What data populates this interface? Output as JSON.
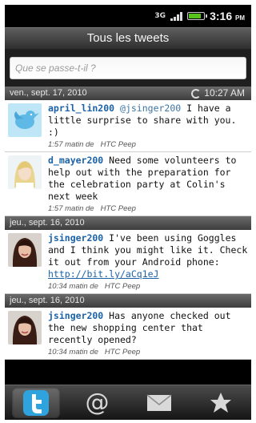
{
  "status_bar": {
    "network": "3G",
    "battery_level": 0.85,
    "time": "3:16",
    "time_suffix": "PM"
  },
  "header": {
    "title": "Tous les tweets"
  },
  "compose": {
    "placeholder": "Que se passe-t-il ?"
  },
  "groups": [
    {
      "date": "ven., sept. 17, 2010",
      "refresh_time": "10:27 AM"
    },
    {
      "date": "jeu., sept. 16, 2010"
    },
    {
      "date": "jeu., sept. 16, 2010"
    }
  ],
  "tweets": [
    {
      "user": "april_lin200",
      "mention": "@jsinger200",
      "text": " I have a little surprise to share with you. :)",
      "time": "1:57 matin de",
      "source": "HTC Peep",
      "avatar": "twitter-bird-avatar"
    },
    {
      "user": "d_mayer200",
      "text": " Need some volunteers to help out with the preparation for the celebration party at Colin's next week",
      "time": "1:57 matin de",
      "source": "HTC Peep",
      "avatar": "blonde-woman-avatar"
    },
    {
      "user": "jsinger200",
      "text": " I've been using Goggles and I think you might like it. Check it out from your Android phone: ",
      "link": "http://bit.ly/aCq1eJ",
      "time": "10:34 matin de",
      "source": "HTC Peep",
      "avatar": "dark-haired-woman-avatar"
    },
    {
      "user": "jsinger200",
      "text": " Has anyone checked out the new shopping center that recently opened?",
      "time": "10:34 matin de",
      "source": "HTC Peep",
      "avatar": "dark-haired-woman-avatar"
    }
  ],
  "tabs": [
    {
      "icon": "twitter-t-icon",
      "active": true
    },
    {
      "icon": "at-mention-icon",
      "glyph": "@"
    },
    {
      "icon": "envelope-icon"
    },
    {
      "icon": "star-icon"
    }
  ],
  "colors": {
    "username": "#1b62a8",
    "battery": "#57c31a",
    "twitter_blue": "#2ea3dd"
  }
}
